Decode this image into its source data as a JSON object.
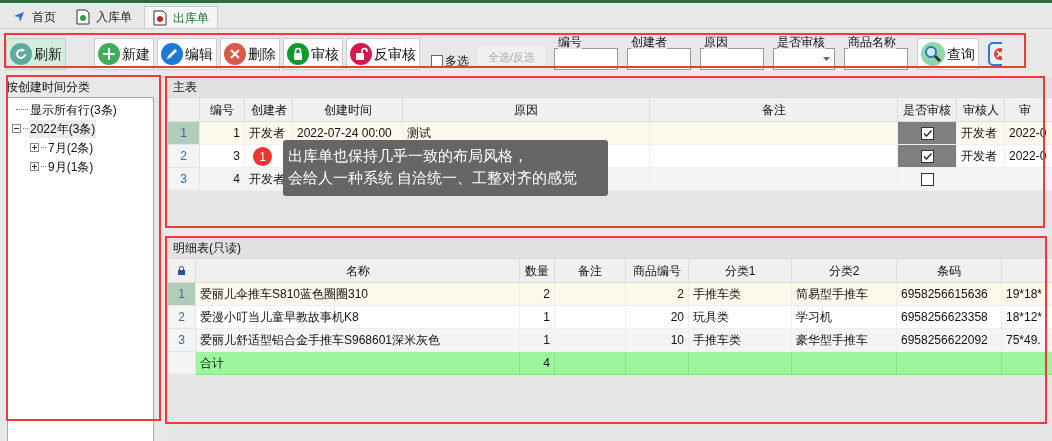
{
  "tabs": [
    {
      "label": "首页",
      "selected": false
    },
    {
      "label": "入库单",
      "selected": false
    },
    {
      "label": "出库单",
      "selected": true
    }
  ],
  "toolbar": {
    "buttons": [
      {
        "label": "刷新",
        "selected": true
      },
      {
        "label": "新建",
        "selected": false
      },
      {
        "label": "编辑",
        "selected": false
      },
      {
        "label": "删除",
        "selected": false
      },
      {
        "label": "审核",
        "selected": false
      },
      {
        "label": "反审核",
        "selected": false
      }
    ],
    "multi_select": {
      "label": "多选",
      "checked": false
    },
    "select_all": {
      "label": "全选/反选",
      "disabled": true
    },
    "filters": [
      {
        "label": "编号",
        "kind": "text"
      },
      {
        "label": "创建者",
        "kind": "text"
      },
      {
        "label": "原因",
        "kind": "text"
      },
      {
        "label": "是否审核",
        "kind": "dropdown"
      },
      {
        "label": "商品名称",
        "kind": "text"
      }
    ],
    "query_button": {
      "label": "查询"
    }
  },
  "sidebar": {
    "title": "按创建时间分类",
    "tree": [
      {
        "label": "显示所有行(3条)"
      },
      {
        "label": "2022年(3条)",
        "expanded": true,
        "selected": true,
        "children": [
          {
            "label": "7月(2条)",
            "expanded": false
          },
          {
            "label": "9月(1条)",
            "expanded": false
          }
        ]
      }
    ]
  },
  "main_table": {
    "title": "主表",
    "columns": [
      "编号",
      "创建者",
      "创建时间",
      "原因",
      "备注",
      "是否审核",
      "审核人",
      "审"
    ],
    "rows": [
      {
        "num": "1",
        "selected": true,
        "cells": [
          "1",
          "开发者",
          "2022-07-24 00:00",
          "测试",
          "",
          null,
          "开发者",
          "2022-0"
        ],
        "checked": true
      },
      {
        "num": "2",
        "selected": false,
        "cells": [
          "3",
          "",
          "",
          "",
          "",
          null,
          "开发者",
          "2022-0"
        ],
        "checked": true
      },
      {
        "num": "3",
        "selected": false,
        "cells": [
          "4",
          "开发者",
          "",
          "",
          "",
          null,
          "",
          ""
        ],
        "checked": false
      }
    ]
  },
  "detail_table": {
    "title": "明细表(只读)",
    "columns": [
      "名称",
      "数量",
      "备注",
      "商品编号",
      "分类1",
      "分类2",
      "条码",
      ""
    ],
    "rows": [
      {
        "num": "1",
        "selected": true,
        "cells": [
          "爱丽儿伞推车S810蓝色圈圈310",
          "2",
          "",
          "2",
          "手推车类",
          "简易型手推车",
          "6958256615636",
          "19*18*"
        ]
      },
      {
        "num": "2",
        "selected": false,
        "cells": [
          "爱漫小叮当儿童早教故事机K8",
          "1",
          "",
          "20",
          "玩具类",
          "学习机",
          "6958256623358",
          "18*12*"
        ]
      },
      {
        "num": "3",
        "selected": false,
        "cells": [
          "爱丽儿舒适型铝合金手推车S968601深米灰色",
          "1",
          "",
          "10",
          "手推车类",
          "豪华型手推车",
          "6958256622092",
          "75*49."
        ]
      }
    ],
    "total": {
      "label": "合计",
      "quantity": "4"
    }
  },
  "tooltip": {
    "badge": "1",
    "lines": [
      "出库单也保持几乎一致的布局风格，",
      "会给人一种系统 自洽统一、工整对齐的感觉"
    ]
  }
}
